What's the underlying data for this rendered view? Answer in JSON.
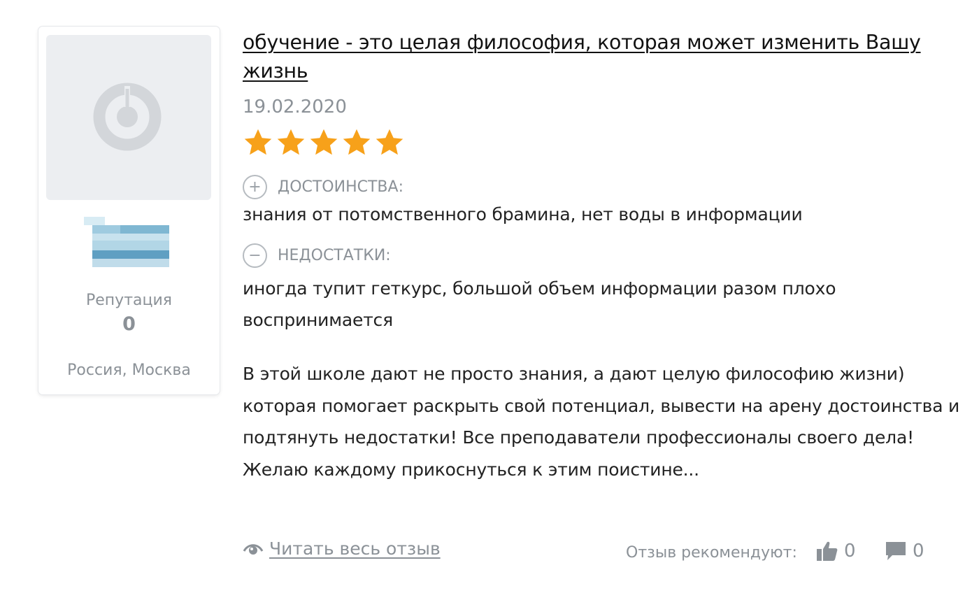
{
  "user": {
    "avatar_icon": "user-placeholder-icon",
    "reputation_label": "Репутация",
    "reputation_value": "0",
    "location": "Россия, Москва"
  },
  "review": {
    "title": "обучение - это целая философия, которая может изменить Вашу жизнь",
    "date": "19.02.2020",
    "rating": 5,
    "rating_max": 5,
    "star_color": "#f7a11a",
    "pros_label": "ДОСТОИНСТВА:",
    "pros_icon": "+",
    "pros_text": "знания от потомственного брамина, нет воды в информации",
    "cons_label": "НЕДОСТАТКИ:",
    "cons_icon": "−",
    "cons_text": "иногда тупит геткурс, большой объем информации разом плохо воспринимается",
    "body": "В этой школе дают не просто знания, а дают целую философию жизни) которая помогает раскрыть свой потенциал, вывести на арену достоинства и подтянуть недостатки! Все преподаватели профессионалы своего дела! Желаю каждому прикоснуться к этим поистине..."
  },
  "footer": {
    "read_more_label": "Читать весь отзыв",
    "recommend_label": "Отзыв рекомендуют:",
    "likes_count": "0",
    "comments_count": "0"
  }
}
